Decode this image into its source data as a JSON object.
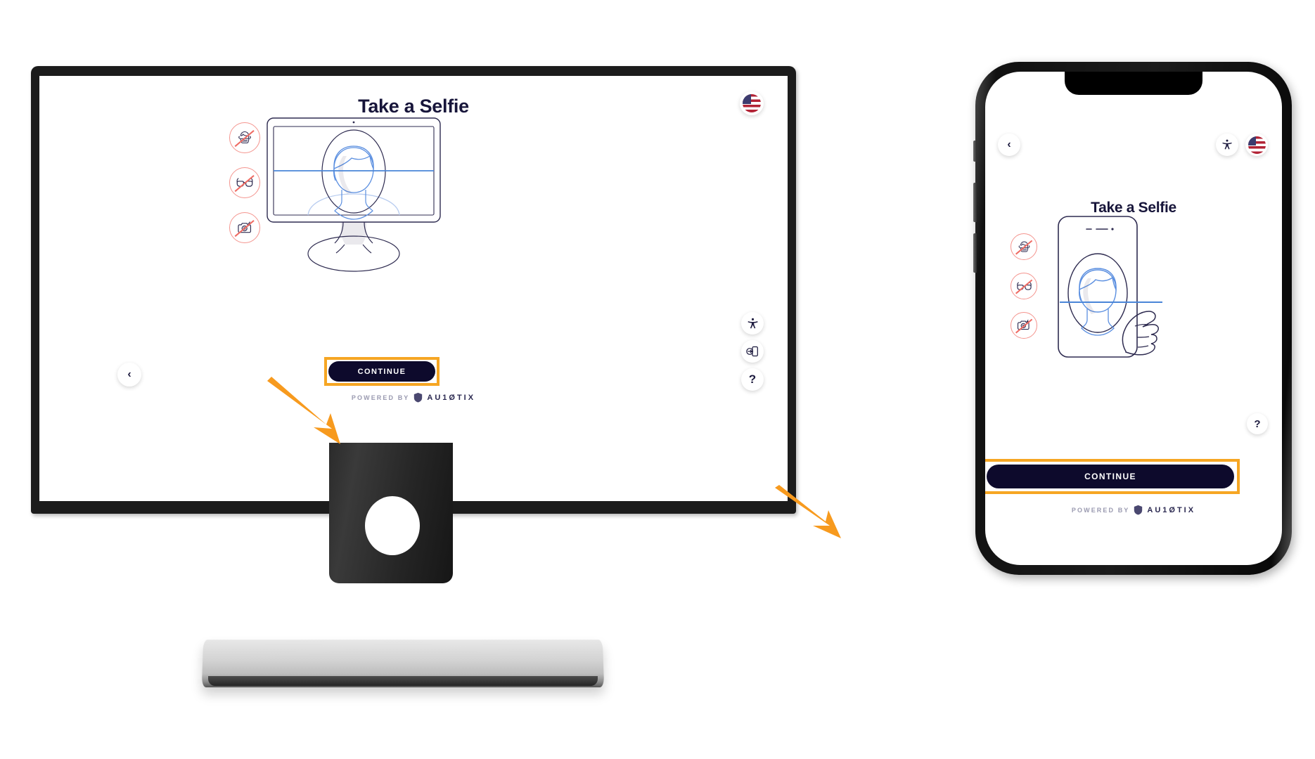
{
  "desktop": {
    "title": "Take a Selfie",
    "language_flag": "us-flag-icon",
    "restrictions": [
      {
        "name": "no-face-mask",
        "label": "No face mask"
      },
      {
        "name": "no-glasses",
        "label": "No glasses"
      },
      {
        "name": "no-camera-flash",
        "label": "No camera flash"
      }
    ],
    "back_label": "‹",
    "tools": [
      {
        "name": "accessibility",
        "glyph": "accessibility-icon"
      },
      {
        "name": "switch-to-mobile",
        "glyph": "phone-switch-icon"
      },
      {
        "name": "help",
        "glyph": "?"
      }
    ],
    "continue_label": "CONTINUE",
    "footer_prefix": "POWERED BY",
    "footer_brand": "AU1ØTIX",
    "illustration": "desktop-monitor-face-scan"
  },
  "phone": {
    "title": "Take a Selfie",
    "language_flag": "us-flag-icon",
    "back_label": "‹",
    "accessibility_glyph": "accessibility-icon",
    "help_glyph": "?",
    "restrictions": [
      {
        "name": "no-face-mask",
        "label": "No face mask"
      },
      {
        "name": "no-glasses",
        "label": "No glasses"
      },
      {
        "name": "no-camera-flash",
        "label": "No camera flash"
      }
    ],
    "continue_label": "CONTINUE",
    "footer_prefix": "POWERED BY",
    "footer_brand": "AU1ØTIX",
    "illustration": "phone-handheld-face-scan"
  },
  "annotations": {
    "desktop_arrow": "orange-arrow-pointing-to-continue",
    "phone_arrow": "orange-arrow-pointing-to-continue",
    "highlight_color": "#f6a623"
  },
  "colors": {
    "ink": "#0d0a2c",
    "accent_orange": "#f6a623",
    "scan_blue": "#4a86d8",
    "prohibit_red": "#ef6b63"
  }
}
